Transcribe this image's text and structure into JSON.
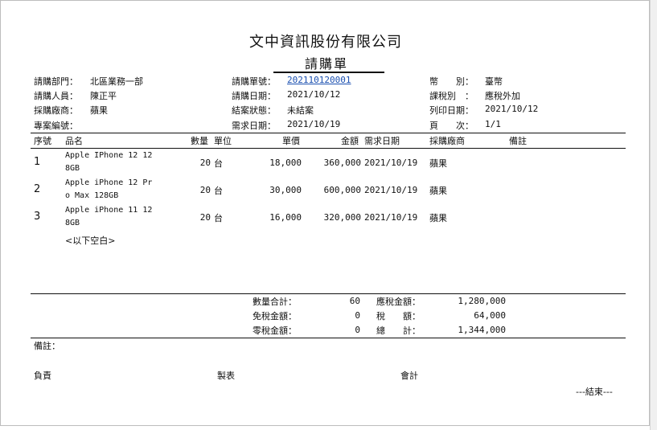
{
  "company": "文中資訊股份有限公司",
  "doc_title": "請購單",
  "header": {
    "dept_label": "請購部門：",
    "dept_value": "北區業務一部",
    "requester_label": "請購人員：",
    "requester_value": "陳正平",
    "vendor_label": "採購廠商：",
    "vendor_value": "蘋果",
    "project_label": "專案編號：",
    "project_value": "",
    "req_no_label": "請購單號：",
    "req_no_value": "202110120001",
    "req_date_label": "請購日期：",
    "req_date_value": "2021/10/12",
    "close_status_label": "結案狀態：",
    "close_status_value": "未結案",
    "need_date_label": "需求日期：",
    "need_date_value": "2021/10/19",
    "currency_label": "幣　　別：",
    "currency_value": "臺幣",
    "tax_label": "課稅別　：",
    "tax_value": "應稅外加",
    "print_date_label": "列印日期：",
    "print_date_value": "2021/10/12",
    "page_label": "頁　　次：",
    "page_value": "1/1"
  },
  "table": {
    "headers": {
      "seq": "序號",
      "name": "品名",
      "qty": "數量",
      "unit": "單位",
      "price": "單價",
      "amount": "金額",
      "need_date": "需求日期",
      "vendor": "採購廠商",
      "note": "備註"
    },
    "rows": [
      {
        "seq": "1",
        "name": "Apple IPhone 12 128GB",
        "qty": "20",
        "unit": "台",
        "price": "18,000",
        "amount": "360,000",
        "need_date": "2021/10/19",
        "vendor": "蘋果"
      },
      {
        "seq": "2",
        "name": "Apple iPhone 12 Pro Max 128GB",
        "qty": "20",
        "unit": "台",
        "price": "30,000",
        "amount": "600,000",
        "need_date": "2021/10/19",
        "vendor": "蘋果"
      },
      {
        "seq": "3",
        "name": "Apple iPhone 11 128GB",
        "qty": "20",
        "unit": "台",
        "price": "16,000",
        "amount": "320,000",
        "need_date": "2021/10/19",
        "vendor": "蘋果"
      }
    ],
    "blank_note": "<以下空白>"
  },
  "totals": {
    "qty_total_label": "數量合計：",
    "qty_total_value": "60",
    "taxfree_label": "免稅金額：",
    "taxfree_value": "0",
    "zerotax_label": "零稅金額：",
    "zerotax_value": "0",
    "taxable_label": "應稅金額：",
    "taxable_value": "1,280,000",
    "tax_label": "稅　　額：",
    "tax_value": "64,000",
    "total_label": "總　　計：",
    "total_value": "1,344,000"
  },
  "footer": {
    "remark_label": "備註：",
    "sign_responsible": "負責",
    "sign_maker": "製表",
    "sign_accounting": "會計",
    "end_mark": "---結束---"
  }
}
